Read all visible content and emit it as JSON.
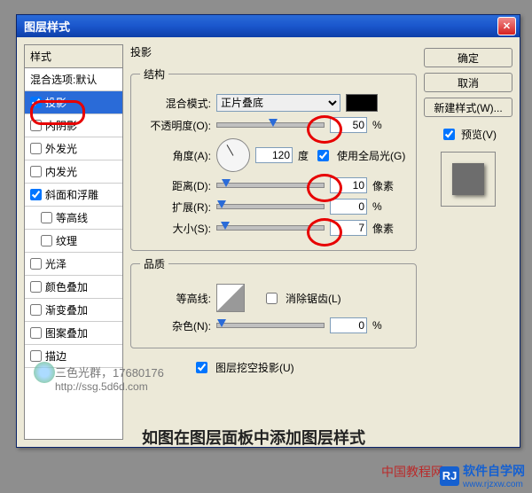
{
  "dialog": {
    "title": "图层样式",
    "close": "✕"
  },
  "stylesPanel": {
    "header": "样式",
    "blendOptions": "混合选项:默认",
    "items": [
      {
        "label": "投影",
        "checked": true,
        "selected": true
      },
      {
        "label": "内阴影",
        "checked": false
      },
      {
        "label": "外发光",
        "checked": false
      },
      {
        "label": "内发光",
        "checked": false
      },
      {
        "label": "斜面和浮雕",
        "checked": true
      },
      {
        "label": "等高线",
        "checked": false,
        "indent": true
      },
      {
        "label": "纹理",
        "checked": false,
        "indent": true
      },
      {
        "label": "光泽",
        "checked": false
      },
      {
        "label": "颜色叠加",
        "checked": false
      },
      {
        "label": "渐变叠加",
        "checked": false
      },
      {
        "label": "图案叠加",
        "checked": false
      },
      {
        "label": "描边",
        "checked": false
      }
    ]
  },
  "shadow": {
    "panelTitle": "投影",
    "structure": {
      "legend": "结构",
      "blendModeLabel": "混合模式:",
      "blendModeValue": "正片叠底",
      "opacityLabel": "不透明度(O):",
      "opacityValue": "50",
      "opacityUnit": "%",
      "angleLabel": "角度(A):",
      "angleValue": "120",
      "angleUnit": "度",
      "globalLight": "使用全局光(G)",
      "distanceLabel": "距离(D):",
      "distanceValue": "10",
      "distanceUnit": "像素",
      "spreadLabel": "扩展(R):",
      "spreadValue": "0",
      "spreadUnit": "%",
      "sizeLabel": "大小(S):",
      "sizeValue": "7",
      "sizeUnit": "像素"
    },
    "quality": {
      "legend": "品质",
      "contourLabel": "等高线:",
      "antiAlias": "消除锯齿(L)",
      "noiseLabel": "杂色(N):",
      "noiseValue": "0",
      "noiseUnit": "%"
    },
    "knockout": "图层挖空投影(U)"
  },
  "buttons": {
    "ok": "确定",
    "cancel": "取消",
    "newStyle": "新建样式(W)...",
    "preview": "预览(V)"
  },
  "note": "如图在图层面板中添加图层样式",
  "watermark": {
    "line1": "三色光群，17680176",
    "line2": "http://ssg.5d6d.com"
  },
  "footer": {
    "text": "软件自学网",
    "url": "www.rjzxw.com",
    "logo": "RJ"
  },
  "footer2": "中国教程网"
}
